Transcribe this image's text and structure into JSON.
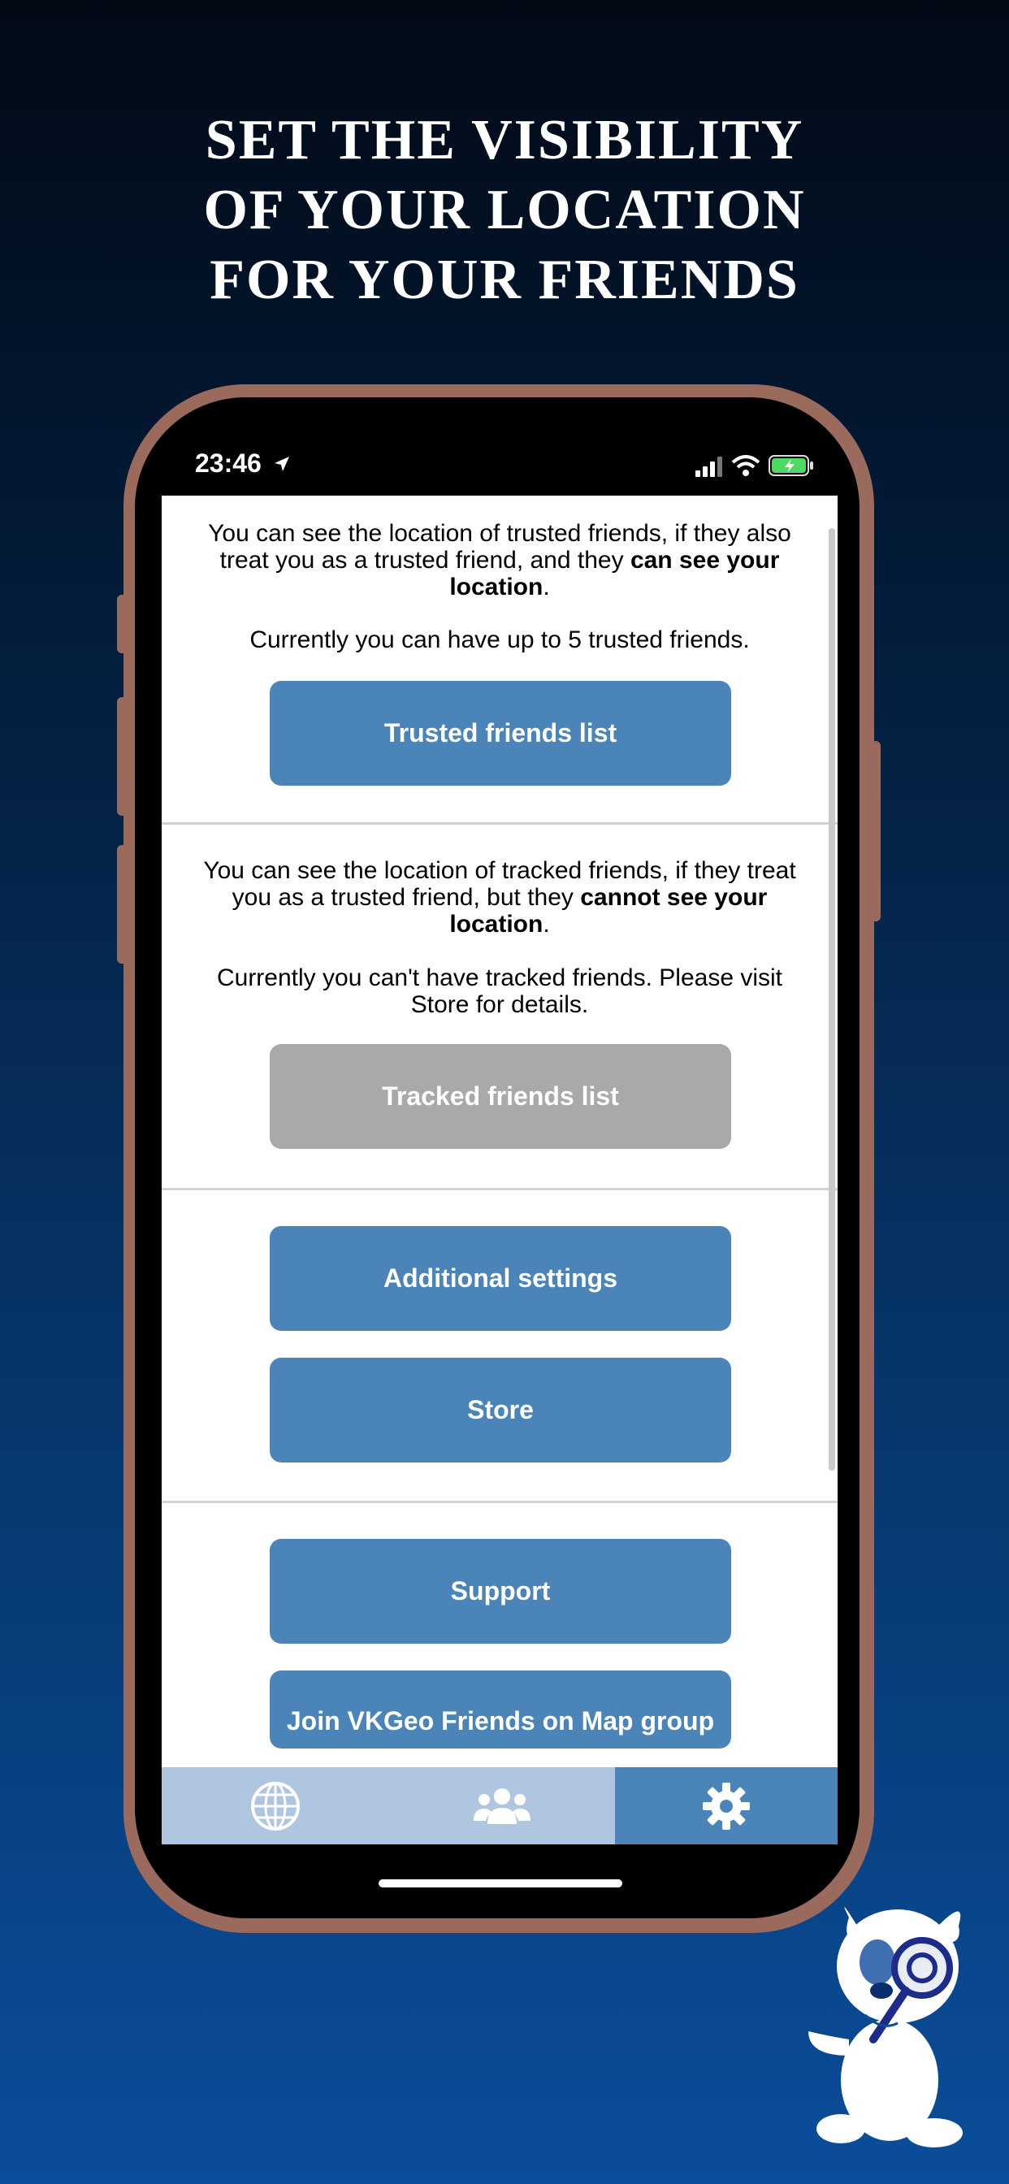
{
  "headline": {
    "line1": "SET THE VISIBILITY",
    "line2": "OF YOUR LOCATION",
    "line3": "FOR YOUR FRIENDS"
  },
  "status_bar": {
    "time": "23:46",
    "icons": [
      "location-arrow-icon",
      "signal-icon",
      "wifi-icon",
      "battery-charging-icon"
    ]
  },
  "trusted": {
    "text_pre": "You can see the location of trusted friends, if they also treat you as a trusted friend, and they ",
    "text_bold": "can see your location",
    "text_post": ".",
    "limit_text": "Currently you can have up to 5 trusted friends.",
    "button": "Trusted friends list"
  },
  "tracked": {
    "text_pre": "You can see the location of tracked friends, if they treat you as a trusted friend, but they ",
    "text_bold": "cannot see your location",
    "text_post": ".",
    "limit_text": "Currently you can't have tracked friends. Please visit Store for details.",
    "button": "Tracked friends list"
  },
  "settings": {
    "additional_button": "Additional settings",
    "store_button": "Store"
  },
  "support": {
    "support_button": "Support",
    "join_button": "Join VKGeo Friends on Map group"
  },
  "tabs": [
    {
      "icon": "globe-icon",
      "active": false
    },
    {
      "icon": "friends-icon",
      "active": false
    },
    {
      "icon": "gear-icon",
      "active": true
    }
  ],
  "colors": {
    "button_blue": "#4b84b8",
    "button_disabled": "#a9a9a9",
    "tab_inactive": "#b0c6e0",
    "tab_active": "#4b84b8",
    "phone_frame": "#9a6a5c"
  }
}
